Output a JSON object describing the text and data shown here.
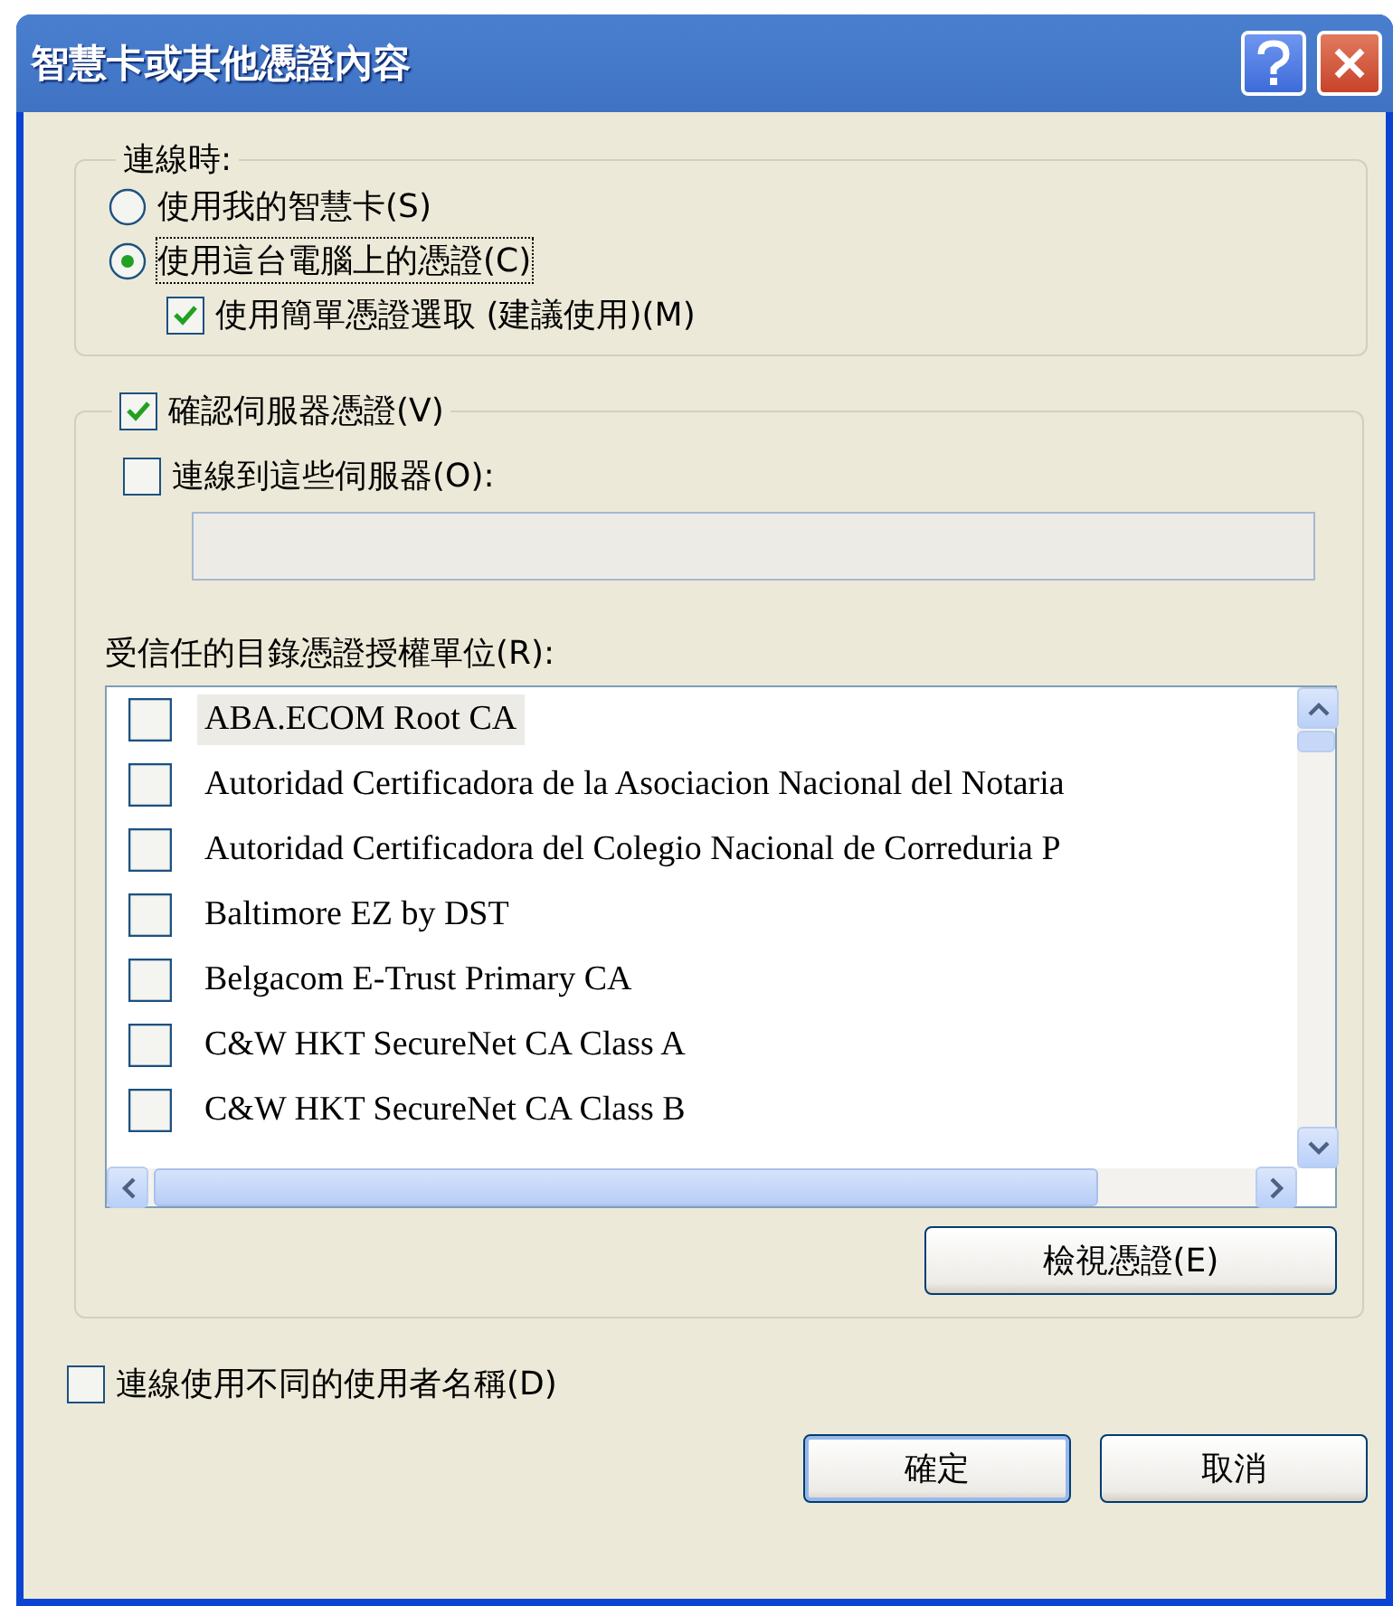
{
  "window": {
    "title": "智慧卡或其他憑證內容"
  },
  "connect_group": {
    "label": "連線時:",
    "options": [
      {
        "label": "使用我的智慧卡(S)",
        "selected": false
      },
      {
        "label": "使用這台電腦上的憑證(C)",
        "selected": true
      }
    ],
    "simple_selection": {
      "label": "使用簡單憑證選取 (建議使用)(M)",
      "checked": true
    }
  },
  "verify_group": {
    "label": "確認伺服器憑證(V)",
    "checked": true,
    "connect_servers": {
      "label": "連線到這些伺服器(O):",
      "checked": false
    },
    "trusted_label": "受信任的目錄憑證授權單位(R):",
    "ca_list": [
      {
        "label": "ABA.ECOM Root CA",
        "checked": false,
        "selected": true
      },
      {
        "label": "Autoridad Certificadora de la Asociacion Nacional del Notaria",
        "checked": false,
        "selected": false
      },
      {
        "label": "Autoridad Certificadora del Colegio Nacional de Correduria P",
        "checked": false,
        "selected": false
      },
      {
        "label": "Baltimore EZ by DST",
        "checked": false,
        "selected": false
      },
      {
        "label": "Belgacom E-Trust Primary CA",
        "checked": false,
        "selected": false
      },
      {
        "label": "C&W HKT SecureNet CA Class A",
        "checked": false,
        "selected": false
      },
      {
        "label": "C&W HKT SecureNet CA Class B",
        "checked": false,
        "selected": false
      }
    ],
    "view_button": "檢視憑證(E)"
  },
  "different_user": {
    "label": "連線使用不同的使用者名稱(D)",
    "checked": false
  },
  "buttons": [
    "確定",
    "取消"
  ]
}
